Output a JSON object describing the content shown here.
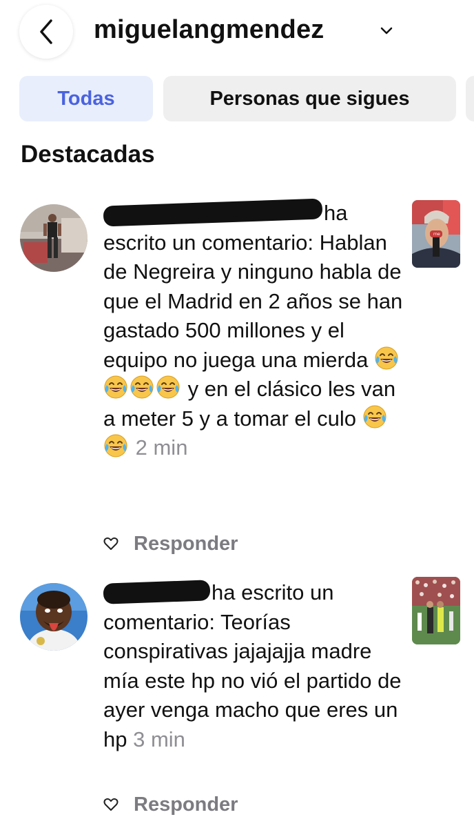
{
  "header": {
    "username": "miguelangmendez"
  },
  "tabs": [
    {
      "label": "Todas",
      "active": true
    },
    {
      "label": "Personas que sigues",
      "active": false
    }
  ],
  "section_title": "Destacadas",
  "colors": {
    "tab_active_bg": "#e8eefc",
    "tab_active_text": "#4a62e0",
    "tab_bg": "#efefef",
    "time_text": "#8e8e93",
    "reply_text": "#7b7b80"
  },
  "comments": [
    {
      "action": "ha escrito un comentario:",
      "body_1": "Hablan de Negreira y ninguno habla de que el Madrid en 2 años se han gastado 500 millones y el equipo no juega una mierda",
      "body_2": "y en el clásico les van a meter 5 y a tomar el culo",
      "time": "2 min",
      "reply": "Responder"
    },
    {
      "action": "ha escrito un comentario:",
      "body_1": "Teorías conspirativas jajajajja madre mía este hp no vió el partido de ayer venga macho que eres un hp",
      "time": "3 min",
      "reply": "Responder"
    }
  ],
  "icons": {
    "back": "chevron-left-icon",
    "dropdown": "chevron-down-icon",
    "like": "heart-outline-icon",
    "emoji": "face-with-tears-of-joy-emoji"
  }
}
